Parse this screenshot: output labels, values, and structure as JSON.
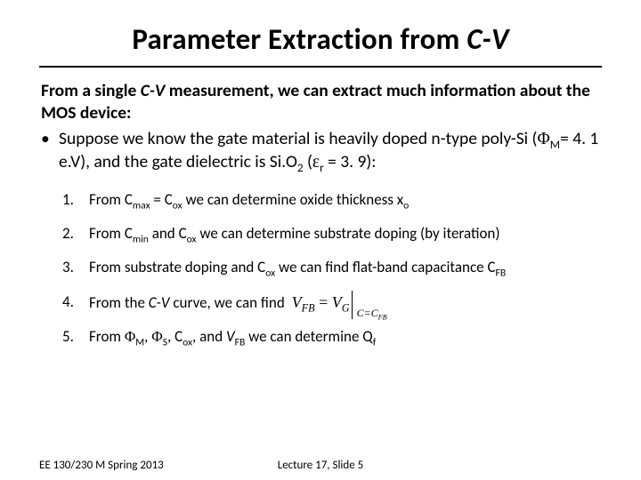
{
  "title_a": "Parameter Extraction from ",
  "title_cv": "C-V",
  "lead_a": "From a single ",
  "lead_cv": "C-V",
  "lead_b": " measurement, we can extract much information about the MOS device:",
  "bullet1_a": "Suppose we know the gate material is heavily doped n-type poly-Si (",
  "bullet1_phi": "Φ",
  "bullet1_msub": "M",
  "bullet1_b": "= 4. 1 e.V), and the gate dielectric is Si.O",
  "bullet1_o2sub": "2",
  "bullet1_c": " (",
  "bullet1_eps": "ε",
  "bullet1_rsub": "r",
  "bullet1_d": " = 3. 9):",
  "items": {
    "n1": "1.",
    "i1_a": "From C",
    "i1_max": "max",
    "i1_b": " = C",
    "i1_ox": "ox",
    "i1_c": " we can determine oxide thickness x",
    "i1_o": "o",
    "n2": "2.",
    "i2_a": "From C",
    "i2_min": "min",
    "i2_b": " and C",
    "i2_ox": "ox",
    "i2_c": " we can determine substrate doping (by iteration)",
    "n3": "3.",
    "i3_a": "From substrate doping and C",
    "i3_ox": "ox",
    "i3_b": " we can find flat-band capacitance C",
    "i3_fb": "FB",
    "n4": "4.",
    "i4_a": "From the ",
    "i4_cv": "C-V",
    "i4_b": " curve, we can find",
    "eq_lhs": "V",
    "eq_lhs_sub": "FB",
    "eq_eq": " = ",
    "eq_rhs": "V",
    "eq_rhs_sub": "G",
    "eq_cond_a": "C=C",
    "eq_cond_sub": "FB",
    "n5": "5.",
    "i5_a": "From ",
    "i5_phi1": "Φ",
    "i5_m": "M",
    "i5_sep1": ", ",
    "i5_phi2": "Φ",
    "i5_s": "S",
    "i5_sep2": ", C",
    "i5_ox": "ox",
    "i5_sep3": ", and ",
    "i5_v": "V",
    "i5_fb": "FB",
    "i5_b": " we can determine Q",
    "i5_f": "f"
  },
  "footer_left": "EE 130/230 M Spring 2013",
  "footer_center": "Lecture 17, Slide 5"
}
